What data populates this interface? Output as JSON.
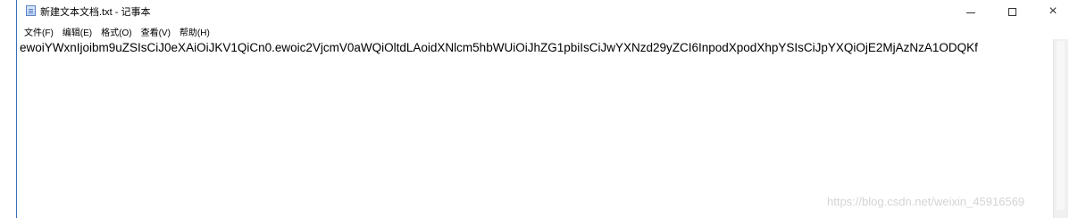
{
  "window": {
    "title": "新建文本文档.txt - 记事本",
    "controls": {
      "minimize": "−",
      "maximize": "□",
      "close": "×"
    }
  },
  "menu": {
    "items": [
      {
        "label": "文件(F)"
      },
      {
        "label": "编辑(E)"
      },
      {
        "label": "格式(O)"
      },
      {
        "label": "查看(V)"
      },
      {
        "label": "帮助(H)"
      }
    ]
  },
  "editor": {
    "content": "ewoiYWxnIjoibm9uZSIsCiJ0eXAiOiJKV1QiCn0.ewoic2VjcmV0aWQiOltdLAoidXNlcm5hbWUiOiJhZG1pbiIsCiJwYXNzd29yZCI6InpodXpodXhpYSIsCiJpYXQiOjE2MjAzNzA1ODQKf"
  },
  "watermark": {
    "text": "https://blog.csdn.net/weixin_45916569"
  },
  "colors": {
    "window_border": "#3b6fb6",
    "background": "#ffffff",
    "watermark": "#d4d4d4"
  },
  "icons": {
    "app": "notepad-icon"
  }
}
